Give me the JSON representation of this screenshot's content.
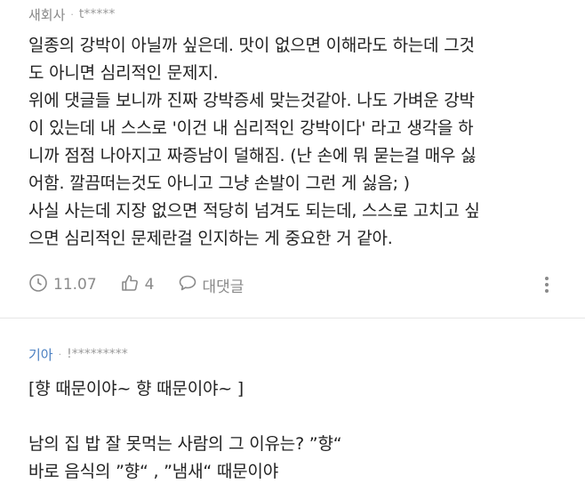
{
  "comments": [
    {
      "author": "새회사",
      "separator": "·",
      "masked_id": "t*****",
      "body": "일종의 강박이 아닐까 싶은데. 맛이 없으면 이해라도 하는데 그것\n도 아니면 심리적인 문제지.\n위에 댓글들 보니까 진짜 강박증세 맞는것같아. 나도 가벼운 강박\n이 있는데 내 스스로 '이건 내 심리적인 강박이다' 라고 생각을 하\n니까 점점 나아지고 짜증남이 덜해짐. (난 손에 뭐 묻는걸 매우 싫\n어함. 깔끔떠는것도 아니고 그냥 손발이 그런 게 싫음; )\n사실 사는데 지장 없으면 적당히 넘겨도 되는데, 스스로 고치고 싶\n으면 심리적인 문제란걸 인지하는 게 중요한 거 같아.",
      "date": "11.07",
      "likes": "4",
      "reply_label": "대댓글"
    },
    {
      "author": "기아",
      "separator": "·",
      "masked_id": "!*********",
      "body": "[향 때문이야~ 향 때문이야~ ]\n\n남의 집 밥 잘 못먹는 사람의 그 이유는? ”향“\n바로 음식의 ”향“ , ”냄새“ 때문이야"
    }
  ],
  "icons": {
    "clock": "clock-icon",
    "like": "thumbs-up-icon",
    "reply": "speech-bubble-icon",
    "more": "more-vertical-icon"
  },
  "colors": {
    "text": "#222222",
    "meta": "#8a8a8a",
    "author_highlight": "#4a7fc1",
    "divider": "#e6e6e6"
  }
}
